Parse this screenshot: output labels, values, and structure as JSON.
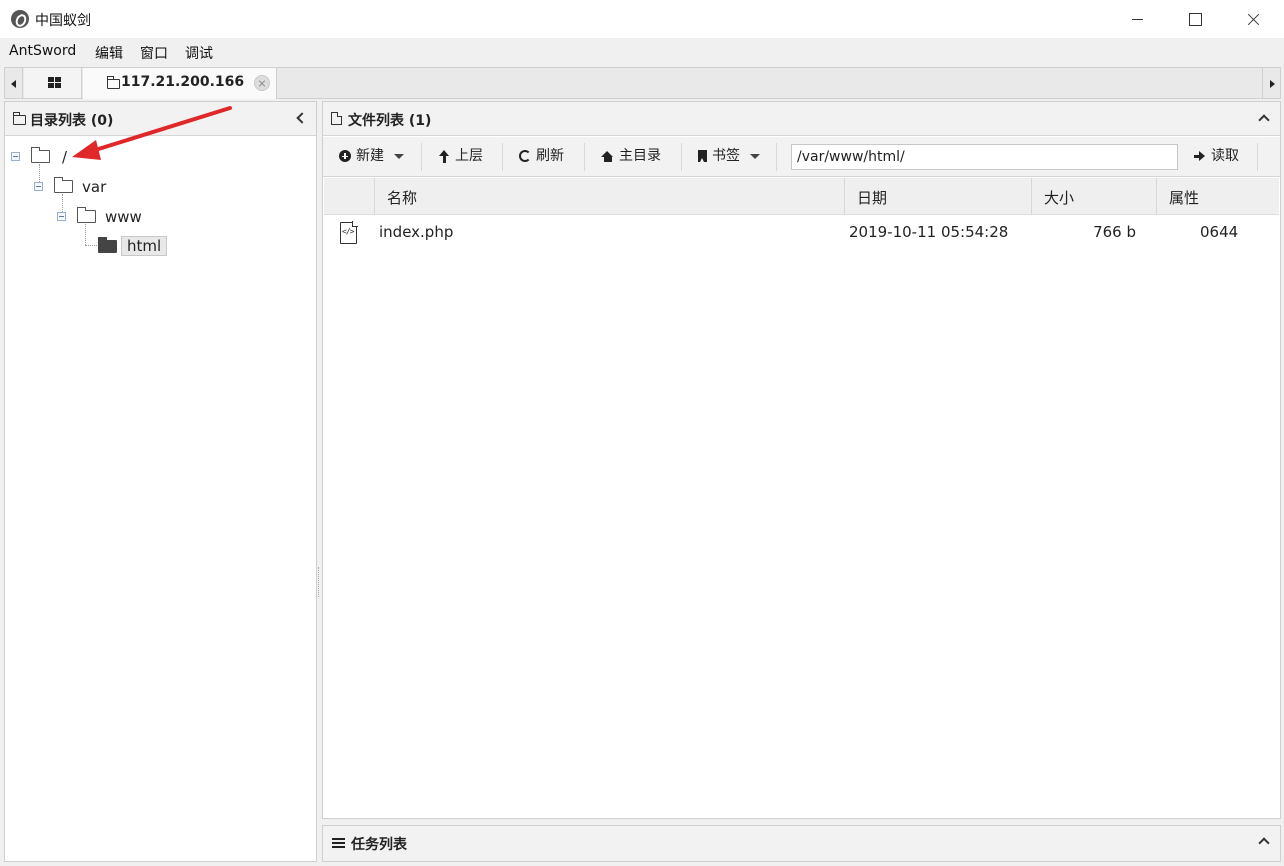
{
  "window": {
    "title": "中国蚁剑",
    "minimize_icon": "minimize-icon",
    "maximize_icon": "maximize-icon",
    "close_icon": "close-icon"
  },
  "menubar": {
    "items": [
      "AntSword",
      "编辑",
      "窗口",
      "调试"
    ]
  },
  "tabs": {
    "home_icon": "grid-icon",
    "active_tab": "117.21.200.166"
  },
  "dir_panel": {
    "title": "目录列表 (0)",
    "tree": [
      {
        "label": "/",
        "level": 0
      },
      {
        "label": "var",
        "level": 1
      },
      {
        "label": "www",
        "level": 2
      },
      {
        "label": "html",
        "level": 3,
        "selected": true
      }
    ]
  },
  "file_panel": {
    "title": "文件列表 (1)",
    "toolbar": {
      "new_label": "新建",
      "up_label": "上层",
      "refresh_label": "刷新",
      "home_label": "主目录",
      "bookmark_label": "书签",
      "path_value": "/var/www/html/",
      "read_label": "读取"
    },
    "columns": [
      "名称",
      "日期",
      "大小",
      "属性"
    ],
    "files": [
      {
        "name": "index.php",
        "date": "2019-10-11 05:54:28",
        "size": "766 b",
        "perm": "0644"
      }
    ]
  },
  "task_panel": {
    "title": "任务列表"
  },
  "colors": {
    "annotation_arrow": "#e0282a",
    "panel_header": "#f2f2f2",
    "background": "#f0f0f0"
  }
}
